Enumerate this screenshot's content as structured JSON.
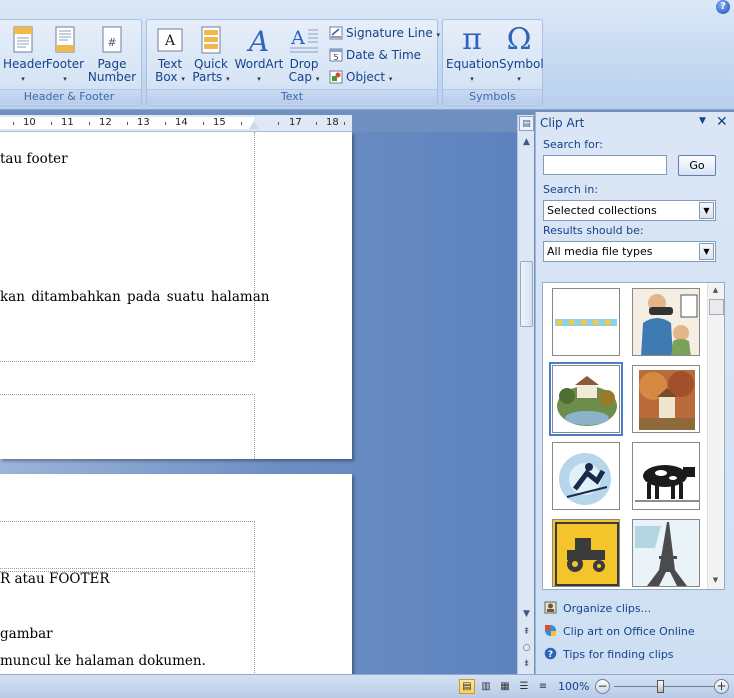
{
  "ribbon": {
    "help_symbol": "?",
    "groups": {
      "header_footer": {
        "label": "Header & Footer",
        "header_label": "Header",
        "footer_label": "Footer",
        "page_number_label_1": "Page",
        "page_number_label_2": "Number"
      },
      "text": {
        "label": "Text",
        "text_box_1": "Text",
        "text_box_2": "Box",
        "quick_parts_1": "Quick",
        "quick_parts_2": "Parts",
        "wordart": "WordArt",
        "drop_cap_1": "Drop",
        "drop_cap_2": "Cap",
        "signature_line": "Signature Line",
        "date_time": "Date & Time",
        "object": "Object"
      },
      "symbols": {
        "label": "Symbols",
        "equation": "Equation",
        "symbol": "Symbol",
        "equation_glyph": "π",
        "symbol_glyph": "Ω"
      }
    },
    "dropdown_arrow": "▾"
  },
  "ruler": {
    "numbers": [
      "10",
      "11",
      "12",
      "13",
      "14",
      "15",
      "17",
      "18"
    ],
    "separator": "·"
  },
  "document": {
    "lines": {
      "line1": "tau footer",
      "line2": "kan  ditambahkan  pada  suatu  halaman",
      "line3": "R atau FOOTER",
      "line4": "gambar",
      "line5": "muncul ke halaman  dokumen."
    }
  },
  "clipart": {
    "title": "Clip Art",
    "search_label": "Search for:",
    "search_value": "",
    "go_label": "Go",
    "search_in_label": "Search in:",
    "search_in_value": "Selected collections",
    "results_label": "Results should be:",
    "results_value": "All media file types",
    "clips": [
      "decorative-border",
      "eye-exam",
      "country-house",
      "autumn-house",
      "ski-jumper",
      "cow",
      "tractor-sign",
      "eiffel-tower"
    ],
    "links": {
      "organize": "Organize clips...",
      "online": "Clip art on Office Online",
      "tips": "Tips for finding clips"
    }
  },
  "statusbar": {
    "zoom": "100%",
    "zoom_minus": "−",
    "zoom_plus": "+"
  }
}
